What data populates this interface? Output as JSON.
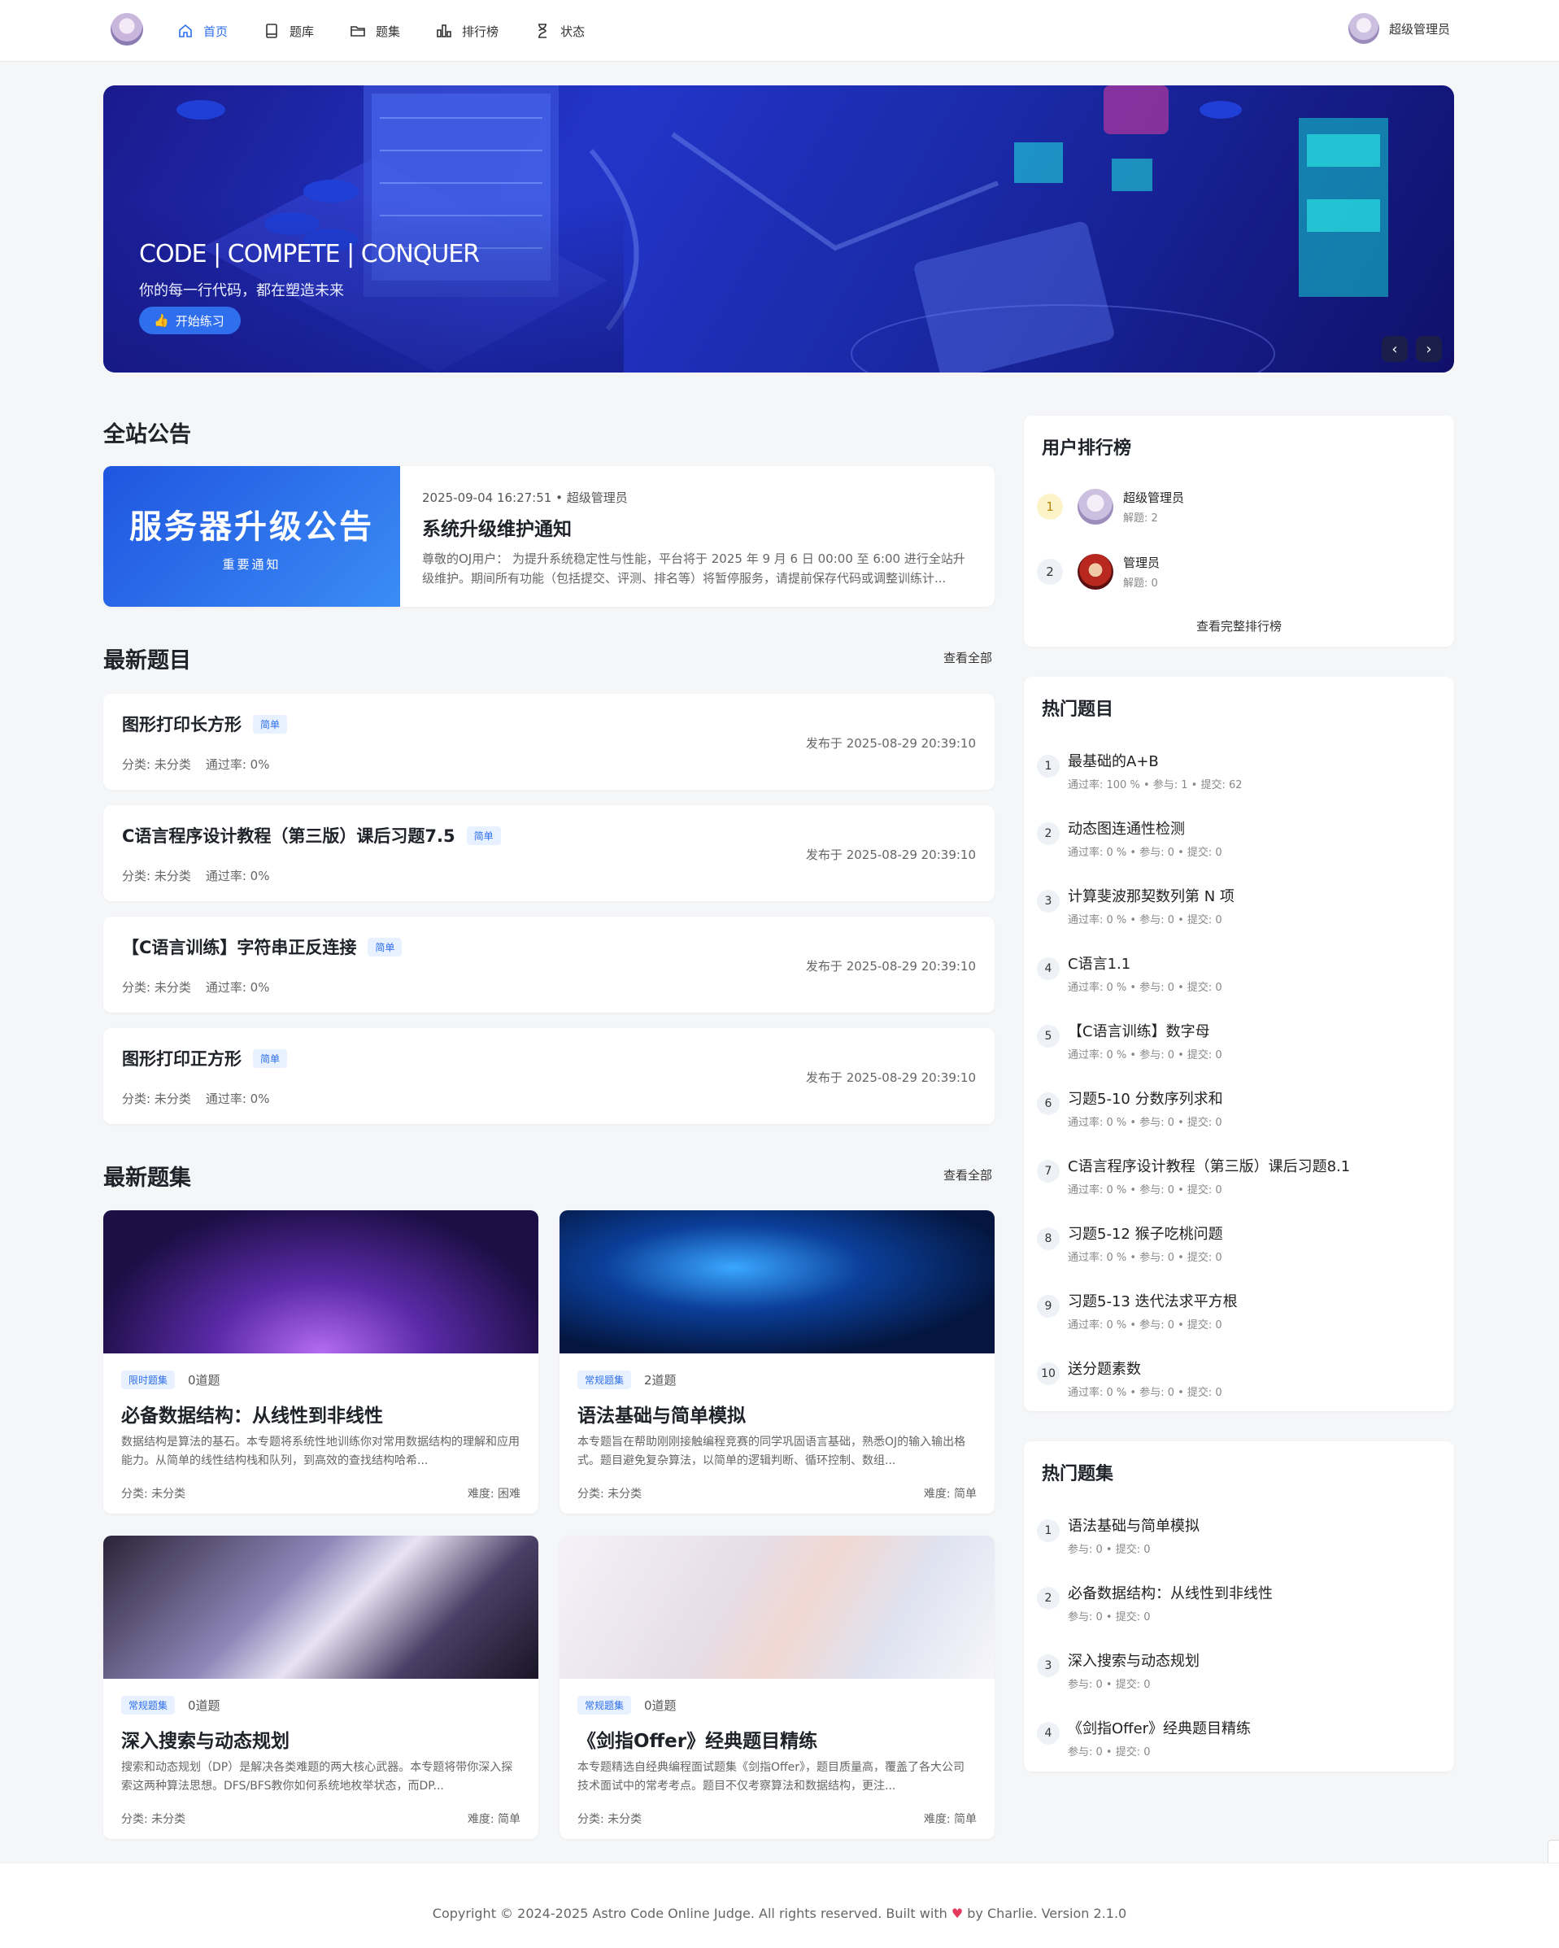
{
  "nav": {
    "logo_alt": "Astro Code",
    "items": [
      {
        "label": "首页",
        "icon": "home-icon",
        "active": true
      },
      {
        "label": "题库",
        "icon": "book-icon"
      },
      {
        "label": "题集",
        "icon": "folder-icon"
      },
      {
        "label": "排行榜",
        "icon": "bar-chart-icon"
      },
      {
        "label": "状态",
        "icon": "hourglass-icon"
      }
    ],
    "user_name": "超级管理员"
  },
  "banner": {
    "title": "CODE | COMPETE | CONQUER",
    "subtitle": "你的每一行代码，都在塑造未来",
    "button": "开始练习",
    "prev": "‹",
    "next": "›"
  },
  "announcement": {
    "section_title": "全站公告",
    "image_title": "服务器升级公告",
    "image_sub": "重要通知",
    "meta": "2025-09-04 16:27:51  •  超级管理员",
    "title": "系统升级维护通知",
    "body": "尊敬的OJ用户： 为提升系统稳定性与性能，平台将于 2025 年 9 月 6 日 00:00 至 6:00 进行全站升级维护。期间所有功能（包括提交、评测、排名等）将暂停服务，请提前保存代码或调整训练计..."
  },
  "latest_problems": {
    "section_title": "最新题目",
    "view_all": "查看全部",
    "items": [
      {
        "name": "图形打印长方形",
        "tag": "简单",
        "category": "分类: 未分类",
        "rate": "通过率: 0%",
        "date": "发布于 2025-08-29 20:39:10"
      },
      {
        "name": "C语言程序设计教程（第三版）课后习题7.5",
        "tag": "简单",
        "category": "分类: 未分类",
        "rate": "通过率: 0%",
        "date": "发布于 2025-08-29 20:39:10"
      },
      {
        "name": "【C语言训练】字符串正反连接",
        "tag": "简单",
        "category": "分类: 未分类",
        "rate": "通过率: 0%",
        "date": "发布于 2025-08-29 20:39:10"
      },
      {
        "name": "图形打印正方形",
        "tag": "简单",
        "category": "分类: 未分类",
        "rate": "通过率: 0%",
        "date": "发布于 2025-08-29 20:39:10"
      }
    ]
  },
  "latest_sets": {
    "section_title": "最新题集",
    "view_all": "查看全部",
    "items": [
      {
        "tag": "限时题集",
        "count": "0道题",
        "title": "必备数据结构：从线性到非线性",
        "desc": "数据结构是算法的基石。本专题将系统性地训练你对常用数据结构的理解和应用能力。从简单的线性结构栈和队列，到高效的查找结构哈希...",
        "category": "分类: 未分类",
        "difficulty": "难度: 困难"
      },
      {
        "tag": "常规题集",
        "count": "2道题",
        "title": "语法基础与简单模拟",
        "desc": "本专题旨在帮助刚刚接触编程竞赛的同学巩固语言基础，熟悉OJ的输入输出格式。题目避免复杂算法，以简单的逻辑判断、循环控制、数组...",
        "category": "分类: 未分类",
        "difficulty": "难度: 简单"
      },
      {
        "tag": "常规题集",
        "count": "0道题",
        "title": "深入搜索与动态规划",
        "desc": "搜索和动态规划（DP）是解决各类难题的两大核心武器。本专题将带你深入探索这两种算法思想。DFS/BFS教你如何系统地枚举状态，而DP...",
        "category": "分类: 未分类",
        "difficulty": "难度: 简单"
      },
      {
        "tag": "常规题集",
        "count": "0道题",
        "title": "《剑指Offer》经典题目精练",
        "desc": "本专题精选自经典编程面试题集《剑指Offer》，题目质量高，覆盖了各大公司技术面试中的常考考点。题目不仅考察算法和数据结构，更注...",
        "category": "分类: 未分类",
        "difficulty": "难度: 简单"
      }
    ]
  },
  "user_rank": {
    "title": "用户排行榜",
    "items": [
      {
        "rank": "1",
        "name": "超级管理员",
        "solved": "解题: 2"
      },
      {
        "rank": "2",
        "name": "管理员",
        "solved": "解题: 0"
      }
    ],
    "more": "查看完整排行榜"
  },
  "hot_problems": {
    "title": "热门题目",
    "items": [
      {
        "rank": "1",
        "name": "最基础的A+B",
        "stats": "通过率: 100 % • 参与: 1 • 提交: 62"
      },
      {
        "rank": "2",
        "name": "动态图连通性检测",
        "stats": "通过率: 0 % • 参与: 0 • 提交: 0"
      },
      {
        "rank": "3",
        "name": "计算斐波那契数列第 N 项",
        "stats": "通过率: 0 % • 参与: 0 • 提交: 0"
      },
      {
        "rank": "4",
        "name": "C语言1.1",
        "stats": "通过率: 0 % • 参与: 0 • 提交: 0"
      },
      {
        "rank": "5",
        "name": "【C语言训练】数字母",
        "stats": "通过率: 0 % • 参与: 0 • 提交: 0"
      },
      {
        "rank": "6",
        "name": "习题5-10 分数序列求和",
        "stats": "通过率: 0 % • 参与: 0 • 提交: 0"
      },
      {
        "rank": "7",
        "name": "C语言程序设计教程（第三版）课后习题8.1",
        "stats": "通过率: 0 % • 参与: 0 • 提交: 0"
      },
      {
        "rank": "8",
        "name": "习题5-12 猴子吃桃问题",
        "stats": "通过率: 0 % • 参与: 0 • 提交: 0"
      },
      {
        "rank": "9",
        "name": "习题5-13 迭代法求平方根",
        "stats": "通过率: 0 % • 参与: 0 • 提交: 0"
      },
      {
        "rank": "10",
        "name": "送分题素数",
        "stats": "通过率: 0 % • 参与: 0 • 提交: 0"
      }
    ]
  },
  "hot_sets": {
    "title": "热门题集",
    "items": [
      {
        "rank": "1",
        "name": "语法基础与简单模拟",
        "stats": "参与: 0 • 提交: 0"
      },
      {
        "rank": "2",
        "name": "必备数据结构：从线性到非线性",
        "stats": "参与: 0 • 提交: 0"
      },
      {
        "rank": "3",
        "name": "深入搜索与动态规划",
        "stats": "参与: 0 • 提交: 0"
      },
      {
        "rank": "4",
        "name": "《剑指Offer》经典题目精练",
        "stats": "参与: 0 • 提交: 0"
      }
    ]
  },
  "footer": {
    "left": "Copyright © 2024-2025 Astro Code Online Judge. All rights reserved. Built with",
    "heart": "♥",
    "right": "by Charlie. Version 2.1.0"
  },
  "colors": {
    "accent": "#2f6fed",
    "background": "#f5f6f8",
    "heart": "#e5395d"
  }
}
